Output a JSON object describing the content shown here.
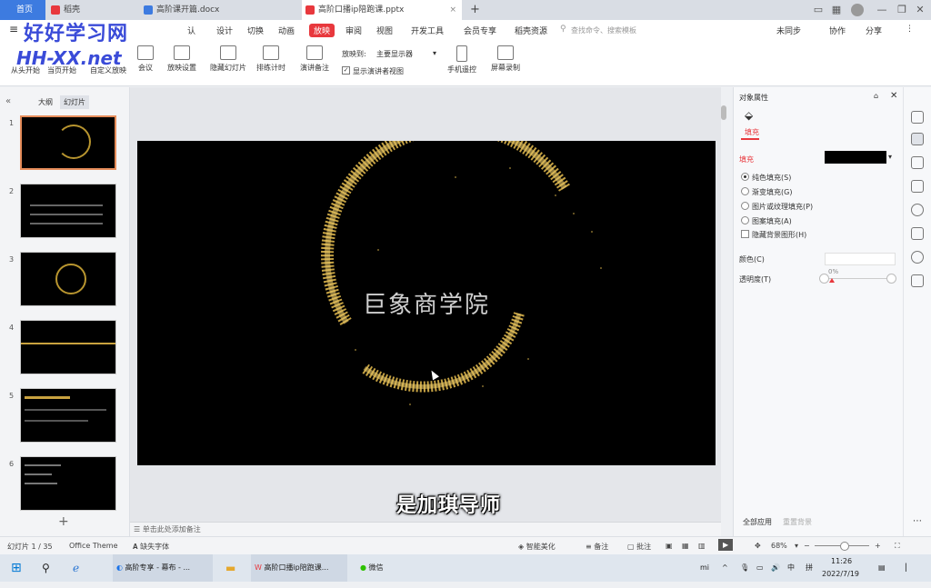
{
  "tabs": [
    {
      "label": "首页",
      "color": "#3d7be0"
    },
    {
      "label": "稻壳",
      "color": "#e8383d"
    },
    {
      "label": "高阶课开篇.docx",
      "color": "#3d7be0"
    },
    {
      "label": "高阶口播ip陪跑课.pptx",
      "color": "#e8383d"
    }
  ],
  "tab_new": "+",
  "window_controls": {
    "minimize": "—",
    "restore": "❐",
    "close": "✕"
  },
  "watermark": {
    "line1": "好好学习网",
    "line2": "HH-XX.net"
  },
  "menu": {
    "items": [
      "认",
      "设计",
      "切换",
      "动画",
      "放映",
      "审阅",
      "视图",
      "开发工具",
      "会员专享",
      "稻壳资源"
    ],
    "active": "放映",
    "search_placeholder": "查找命令、搜索模板",
    "right": [
      "未同步",
      "协作",
      "分享"
    ]
  },
  "ribbon": {
    "buttons": [
      "从头开始",
      "当页开始",
      "自定义放映",
      "会议",
      "放映设置",
      "隐藏幻灯片",
      "排练计时",
      "演讲备注",
      "手机遥控",
      "屏幕录制"
    ],
    "monitor_label": "放映到:",
    "monitor_value": "主要显示器",
    "presenter_view": "显示演讲者视图"
  },
  "left_panel": {
    "tabs": [
      "大纲",
      "幻灯片"
    ],
    "slide_numbers": [
      "1",
      "2",
      "3",
      "4",
      "5",
      "6"
    ],
    "add_slide": "+"
  },
  "slide": {
    "title": "巨象商学院"
  },
  "notes_placeholder": "单击此处添加备注",
  "right_panel": {
    "title": "对象属性",
    "tab": "填充",
    "section": "填充",
    "fill_options": [
      "纯色填充(S)",
      "渐变填充(G)",
      "图片或纹理填充(P)",
      "图案填充(A)"
    ],
    "selected_fill": 0,
    "hide_bg": "隐藏背景图形(H)",
    "color_label": "颜色(C)",
    "transparency_label": "透明度(T)",
    "transparency_value": "0%",
    "apply_all": "全部应用",
    "reset_bg": "重置背景",
    "fill_color": "#000000"
  },
  "status": {
    "slide_count": "幻灯片 1 / 35",
    "theme": "Office Theme",
    "missing_font": "缺失字体",
    "beautify": "智能美化",
    "notes": "备注",
    "comments": "批注",
    "zoom": "68%"
  },
  "subtitle": "是加琪导师",
  "taskbar": {
    "apps": [
      "高阶专享 - 幕布 - ...",
      "高阶口播ip陪跑课...",
      "微信"
    ],
    "ime": "中",
    "ime2": "拼",
    "time": "11:26",
    "date": "2022/7/19"
  },
  "colors": {
    "accent": "#e8383d",
    "gold": "#d9b34a"
  }
}
